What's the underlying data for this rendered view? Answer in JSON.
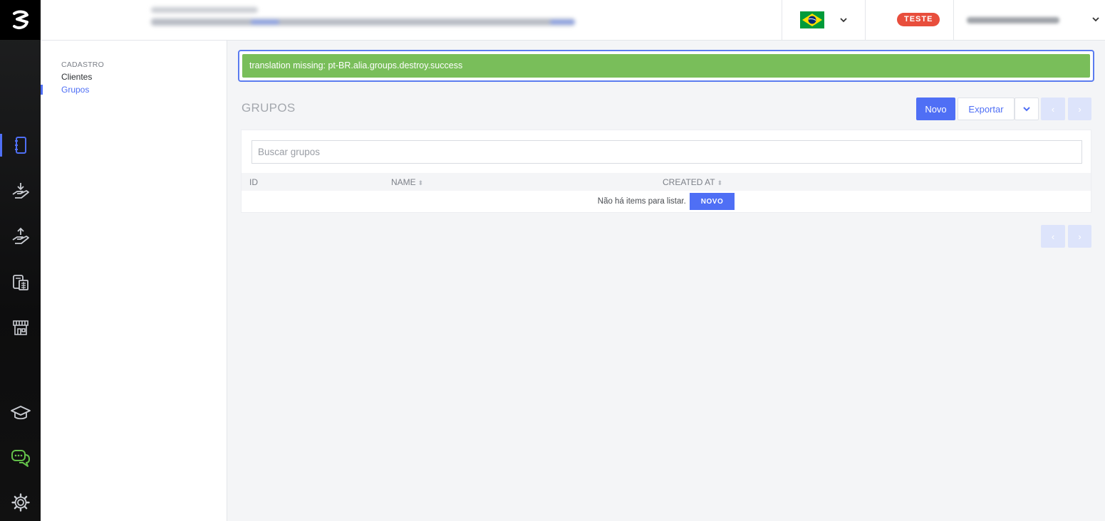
{
  "sidebar": {
    "section_title": "CADASTRO",
    "items": [
      {
        "label": "Clientes"
      },
      {
        "label": "Grupos",
        "active": true
      }
    ]
  },
  "rail": {
    "icons": [
      "logo-icon",
      "cadastro-icon",
      "receive-money-icon",
      "send-money-icon",
      "calculator-icon",
      "store-icon",
      "academy-icon",
      "chat-support-icon",
      "settings-icon"
    ]
  },
  "topbar": {
    "language": "pt-BR",
    "env_badge": "TESTE"
  },
  "alert": {
    "message": "translation missing: pt-BR.alia.groups.destroy.success"
  },
  "page": {
    "title": "GRUPOS",
    "new_label": "Novo",
    "export_label": "Exportar",
    "prev": "‹",
    "next": "›"
  },
  "search": {
    "placeholder": "Buscar grupos"
  },
  "table": {
    "columns": [
      {
        "label": "ID",
        "sortable": false
      },
      {
        "label": "NAME",
        "sortable": true
      },
      {
        "label": "CREATED AT",
        "sortable": true
      }
    ],
    "empty_text": "Não há items para listar.",
    "empty_new_label": "NOVO"
  },
  "colors": {
    "accent": "#4f6ff5",
    "success": "#79be5a",
    "badge": "#e84e3c",
    "chat_icon": "#63c04a"
  }
}
